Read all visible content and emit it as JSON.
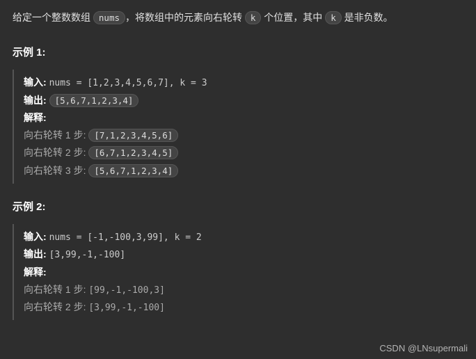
{
  "intro": {
    "t1": "给定一个整数数组 ",
    "code1": "nums",
    "t2": "，将数组中的元素向右轮转 ",
    "code2": "k",
    "t3": " 个位置，其中 ",
    "code3": "k",
    "t4": " 是非负数。"
  },
  "example1": {
    "title": "示例 1:",
    "input_label": "输入:",
    "input_value": " nums = [1,2,3,4,5,6,7], k = 3",
    "output_label": "输出:",
    "output_value": "[5,6,7,1,2,3,4]",
    "explain_label": "解释:",
    "steps": [
      {
        "text": "向右轮转 1 步: ",
        "arr": "[7,1,2,3,4,5,6]"
      },
      {
        "text": "向右轮转 2 步: ",
        "arr": "[6,7,1,2,3,4,5]"
      },
      {
        "text": "向右轮转 3 步: ",
        "arr": "[5,6,7,1,2,3,4]"
      }
    ]
  },
  "example2": {
    "title": "示例 2:",
    "input_label": "输入:",
    "input_value": "nums = [-1,-100,3,99], k = 2",
    "output_label": "输出:",
    "output_value": "[3,99,-1,-100]",
    "explain_label": "解释:",
    "steps": [
      {
        "text": "向右轮转 1 步: ",
        "arr": "[99,-1,-100,3]"
      },
      {
        "text": "向右轮转 2 步: ",
        "arr": "[3,99,-1,-100]"
      }
    ]
  },
  "watermark": "CSDN @LNsupermali"
}
